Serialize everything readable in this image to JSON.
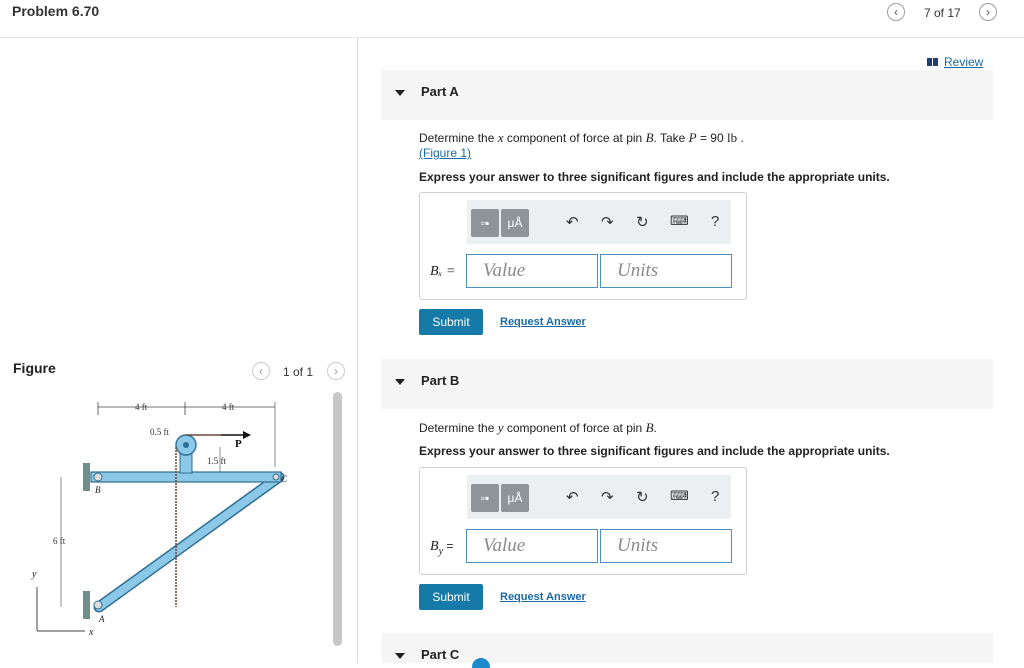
{
  "header": {
    "title": "Problem 6.70",
    "page_count": "7 of 17",
    "prev_icon": "chevron-left-icon",
    "next_icon": "chevron-right-icon"
  },
  "review": {
    "label": "Review",
    "icon": "book-icon"
  },
  "figure_panel": {
    "label": "Figure",
    "count": "1 of 1",
    "diagram_labels": {
      "dim_4ft_left": "4 ft",
      "dim_4ft_right": "4 ft",
      "dim_05ft": "0.5 ft",
      "dim_15ft": "1.5 ft",
      "dim_6ft": "6 ft",
      "force_P": "P",
      "pin_B": "B",
      "pin_C": "C",
      "pin_A": "A",
      "axis_y": "y",
      "axis_x": "x"
    }
  },
  "parts": [
    {
      "label": "Part A",
      "question_pre": "Determine the ",
      "question_var": "x",
      "question_mid": " component of force at pin ",
      "question_pin": "B",
      "question_take": ". Take ",
      "question_P": "P",
      "question_value": " = 90 ",
      "question_unit": "lb",
      "question_end": " .",
      "figure_link": "(Figure 1)",
      "instruction": "Express your answer to three significant figures and include the appropriate units.",
      "variable": "Bₓ =",
      "value_placeholder": "Value",
      "units_placeholder": "Units",
      "submit": "Submit",
      "request": "Request Answer"
    },
    {
      "label": "Part B",
      "question_pre": "Determine the ",
      "question_var": "y",
      "question_mid": " component of force at pin ",
      "question_pin": "B",
      "question_end": ".",
      "instruction": "Express your answer to three significant figures and include the appropriate units.",
      "variable": "B",
      "variable_sub": "y",
      "variable_eq": " =",
      "value_placeholder": "Value",
      "units_placeholder": "Units",
      "submit": "Submit",
      "request": "Request Answer"
    },
    {
      "label": "Part C"
    }
  ],
  "toolbar": {
    "units_btn": "μÅ",
    "help": "?",
    "icons": [
      "templates-icon",
      "units-icon",
      "undo-icon",
      "redo-icon",
      "reset-icon",
      "keyboard-icon",
      "help-icon"
    ]
  },
  "colors": {
    "link": "#1a6aa8",
    "submit": "#167aa8",
    "member": "#8cc8e8",
    "header_bg": "#f5f5f5"
  }
}
